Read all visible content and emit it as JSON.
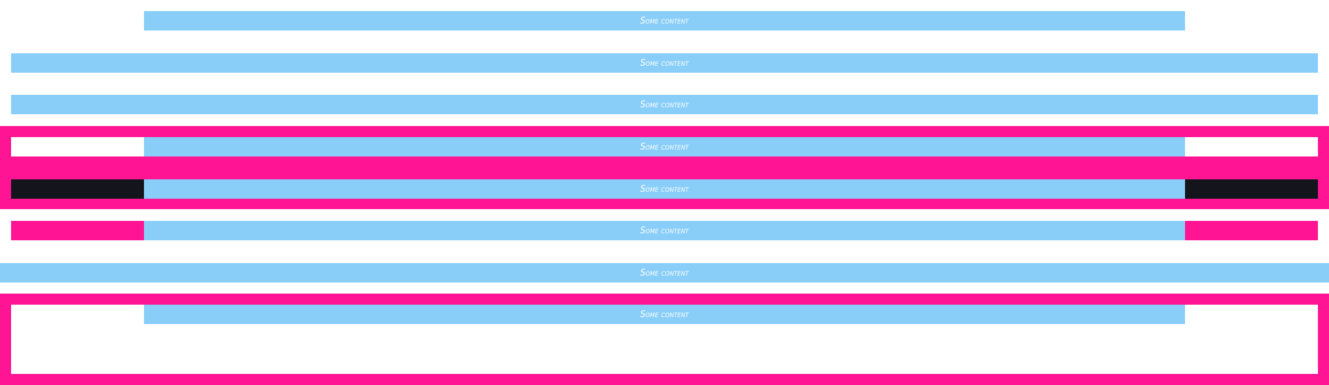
{
  "colors": {
    "content_bar": "#89CEF9",
    "accent_pink": "#FF1493",
    "dark_block": "#14141C",
    "background": "#FFFFFF",
    "text": "#FFFFFF"
  },
  "rows": [
    {
      "label": "Some content"
    },
    {
      "label": "Some content"
    },
    {
      "label": "Some content"
    },
    {
      "label": "Some content"
    },
    {
      "label": "Some content"
    },
    {
      "label": "Some content"
    },
    {
      "label": "Some content"
    },
    {
      "label": "Some content"
    }
  ]
}
